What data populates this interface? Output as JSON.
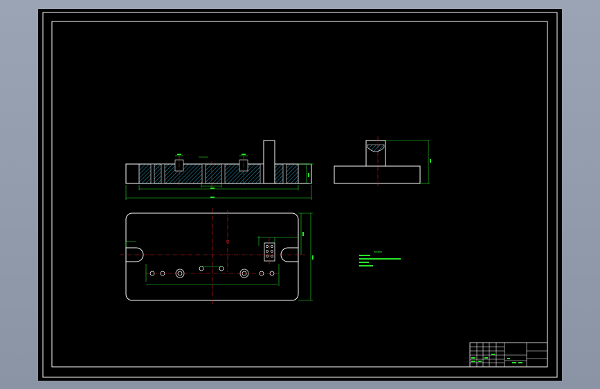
{
  "drawing": {
    "colors": {
      "background": "#000000",
      "frame": "#ffffff",
      "outline": "#ffffff",
      "dimension": "#28e628",
      "centerline": "#e02020",
      "hatch": "#2a9fbf",
      "viewport": "#8e98a8"
    },
    "notes": {
      "title": "技术要求",
      "lines": [
        "",
        "",
        "",
        ""
      ]
    },
    "title_block": {
      "drawing_name": "",
      "material": "",
      "scale": ""
    }
  }
}
